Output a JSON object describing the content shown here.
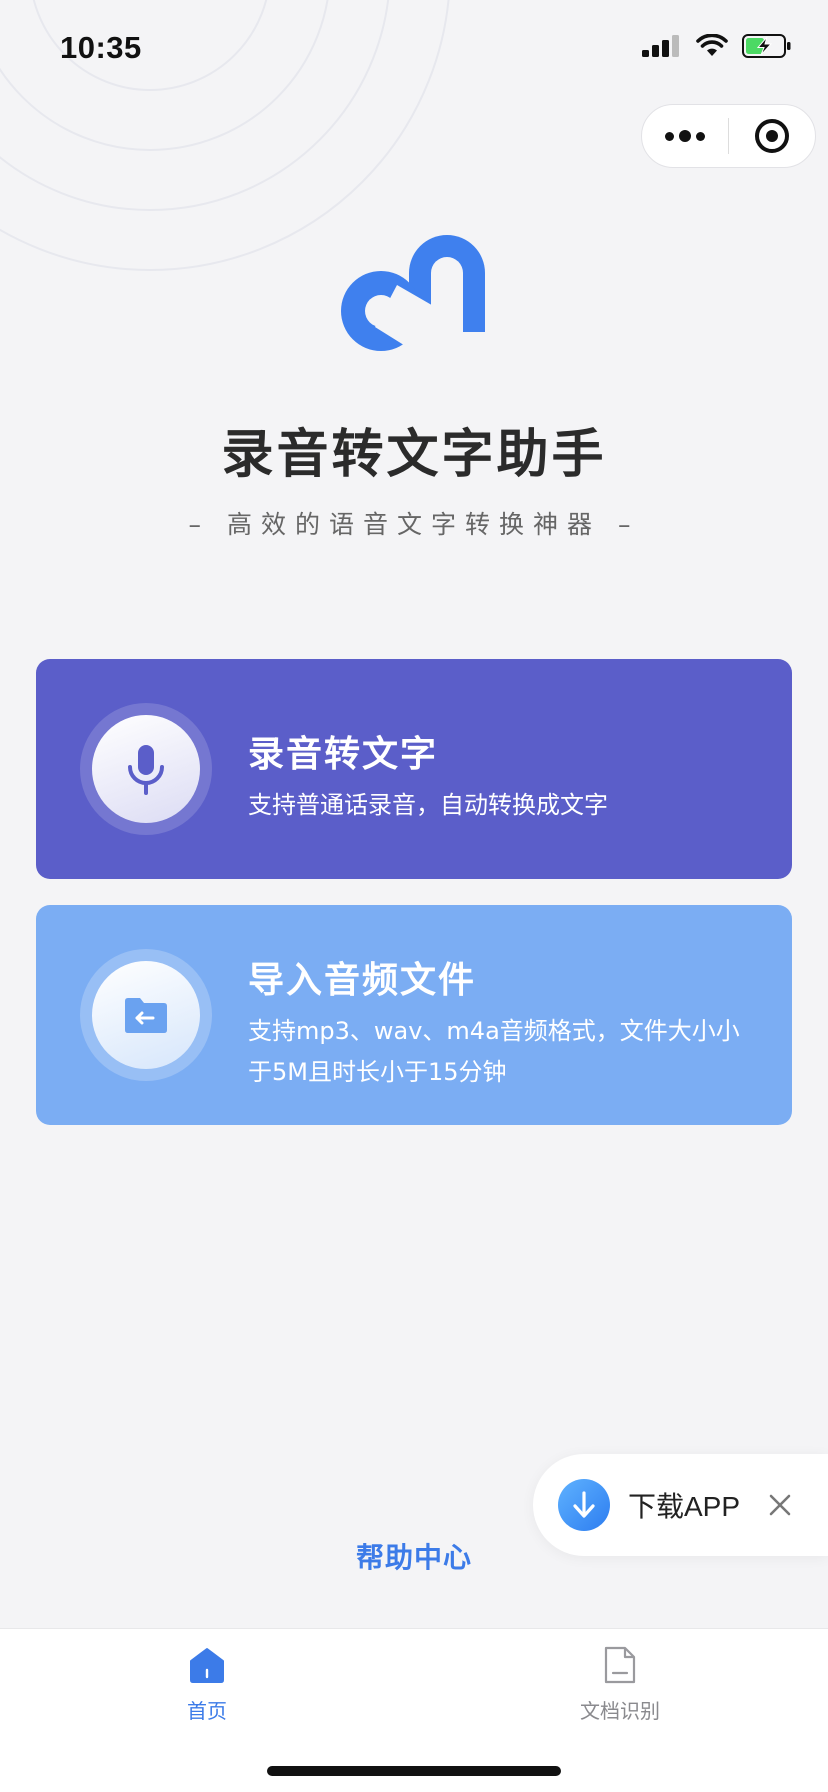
{
  "status_bar": {
    "time": "10:35"
  },
  "app": {
    "title": "录音转文字助手",
    "subtitle": "– 高效的语音文字转换神器 –"
  },
  "cards": [
    {
      "title": "录音转文字",
      "description": "支持普通话录音，自动转换成文字",
      "icon": "microphone-icon",
      "color": "#5b5ec9"
    },
    {
      "title": "导入音频文件",
      "description": "支持mp3、wav、m4a音频格式，文件大小小于5M且时长小于15分钟",
      "icon": "folder-import-icon",
      "color": "#7badf3"
    }
  ],
  "download_banner": {
    "label": "下载APP"
  },
  "help": {
    "label": "帮助中心"
  },
  "tab_bar": {
    "items": [
      {
        "label": "首页",
        "icon": "home-icon",
        "active": true
      },
      {
        "label": "文档识别",
        "icon": "document-icon",
        "active": false
      }
    ]
  },
  "colors": {
    "accent": "#3c7be8",
    "card_primary": "#5b5ec9",
    "card_secondary": "#7badf3",
    "background": "#f4f4f6"
  }
}
